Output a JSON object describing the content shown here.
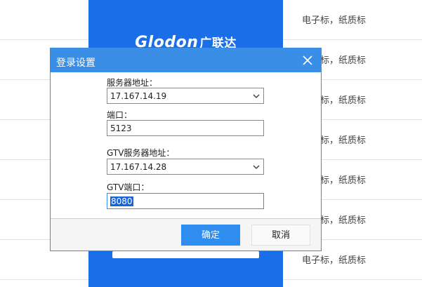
{
  "background": {
    "rows": [
      {
        "text": "电子标，纸质标"
      },
      {
        "text": "电子标，纸质标"
      },
      {
        "text": "电子标，纸质标"
      },
      {
        "text": "电子标，纸质标"
      },
      {
        "text": "电子标，纸质标"
      },
      {
        "text": "电子标，纸质标"
      },
      {
        "text": "电子标，纸质标"
      }
    ],
    "brand": {
      "latin": "Glodon",
      "cn": "广联达"
    }
  },
  "dialog": {
    "title": "登录设置",
    "fields": {
      "server_address": {
        "label": "服务器地址：",
        "value": "17.167.14.19"
      },
      "port": {
        "label": "端口：",
        "value": "5123"
      },
      "gtv_server_address": {
        "label": "GTV服务器地址：",
        "value": "17.167.14.28"
      },
      "gtv_port": {
        "label": "GTV端口：",
        "value": "8080"
      }
    },
    "buttons": {
      "ok": "确定",
      "cancel": "取消"
    }
  },
  "colors": {
    "accent": "#3a8ee6",
    "panel_blue": "#1a6ee8",
    "ok_button": "#2f8df0"
  }
}
